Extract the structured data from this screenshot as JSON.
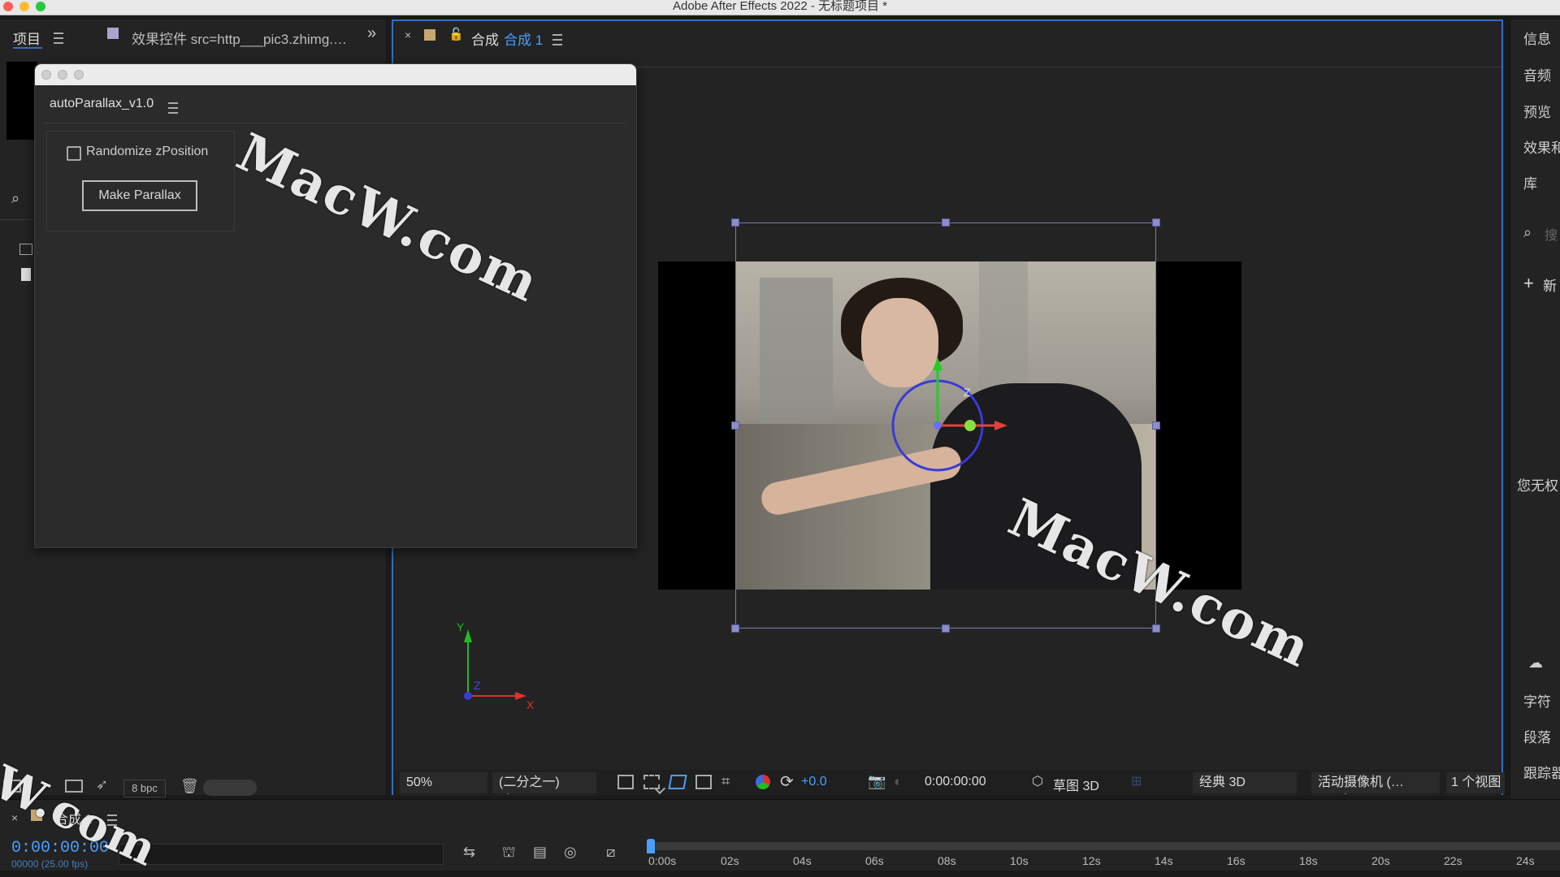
{
  "app": {
    "title": "Adobe After Effects 2022 - 无标题项目 *"
  },
  "project_panel": {
    "tab_label": "项目",
    "effects_tab_label": "效果控件 src=http___pic3.zhimg.…",
    "bpc_label": "8 bpc"
  },
  "comp_panel": {
    "tab_prefix": "合成",
    "tab_name": "合成 1"
  },
  "script_window": {
    "title": "autoParallax_v1.0",
    "checkbox_label": "Randomize zPosition",
    "checkbox_checked": false,
    "button_label": "Make Parallax"
  },
  "viewer": {
    "axis_y": "Y",
    "axis_z": "Z",
    "axis_x": "X",
    "gizmo_z": "Z"
  },
  "comp_toolbar": {
    "zoom": "50%",
    "resolution": "(二分之一)",
    "exposure": "+0.0",
    "timecode": "0:00:00:00",
    "draft3d": "草图 3D",
    "renderer": "经典 3D",
    "camera": "活动摄像机 (…",
    "views": "1 个视图"
  },
  "right_panel": {
    "items": [
      "信息",
      "音频",
      "预览",
      "效果和",
      "库"
    ],
    "search_glyph": "搜",
    "new_label": "新",
    "no_permission": "您无权",
    "bottom_items": [
      "字符",
      "段落",
      "跟踪器"
    ]
  },
  "timeline": {
    "comp_tab": "合成 1",
    "timecode": "0:00:00:00",
    "frame_info": "00000 (25.00 fps)",
    "ticks": [
      "0:00s",
      "02s",
      "04s",
      "06s",
      "08s",
      "10s",
      "12s",
      "14s",
      "16s",
      "18s",
      "20s",
      "22s",
      "24s"
    ]
  },
  "watermarks": [
    "MacW.com",
    "MacW.com",
    "W.com"
  ]
}
